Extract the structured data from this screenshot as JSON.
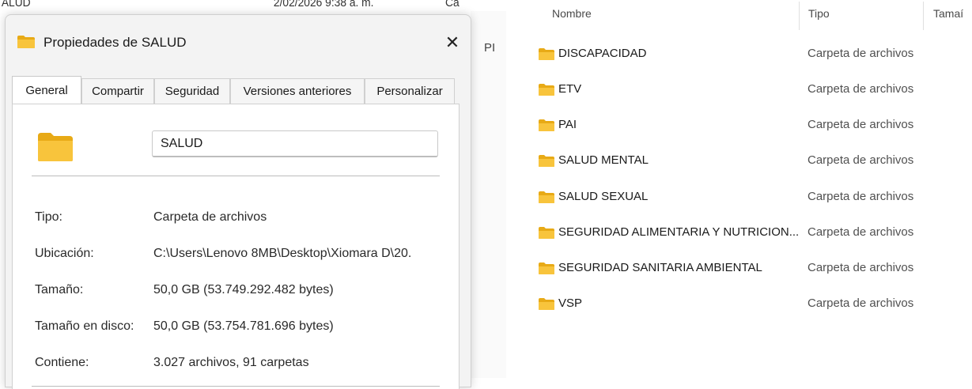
{
  "background": {
    "row_partial": {
      "name": "ALUD",
      "date": "2/02/2026 9:38 a. m.",
      "type": "Ca"
    },
    "right_pane_text": "PI"
  },
  "dialog": {
    "title": "Propiedades de SALUD",
    "close_label": "✕",
    "tabs": [
      {
        "label": "General",
        "active": true
      },
      {
        "label": "Compartir",
        "active": false
      },
      {
        "label": "Seguridad",
        "active": false
      },
      {
        "label": "Versiones anteriores",
        "active": false
      },
      {
        "label": "Personalizar",
        "active": false
      }
    ],
    "folder_name": "SALUD",
    "properties": [
      {
        "label": "Tipo:",
        "value": "Carpeta de archivos"
      },
      {
        "label": "Ubicación:",
        "value": "C:\\Users\\Lenovo 8MB\\Desktop\\Xiomara D\\20."
      },
      {
        "label": "Tamaño:",
        "value": "50,0 GB (53.749.292.482 bytes)"
      },
      {
        "label": "Tamaño en disco:",
        "value": "50,0 GB (53.754.781.696 bytes)"
      },
      {
        "label": "Contiene:",
        "value": "3.027 archivos, 91 carpetas"
      }
    ]
  },
  "explorer": {
    "columns": {
      "name": "Nombre",
      "type": "Tipo",
      "size": "Tamaí"
    },
    "items": [
      {
        "name": "DISCAPACIDAD",
        "type": "Carpeta de archivos"
      },
      {
        "name": "ETV",
        "type": "Carpeta de archivos"
      },
      {
        "name": "PAI",
        "type": "Carpeta de archivos"
      },
      {
        "name": "SALUD MENTAL",
        "type": "Carpeta de archivos"
      },
      {
        "name": "SALUD SEXUAL",
        "type": "Carpeta de archivos"
      },
      {
        "name": "SEGURIDAD ALIMENTARIA Y NUTRICION...",
        "type": "Carpeta de archivos"
      },
      {
        "name": "SEGURIDAD SANITARIA AMBIENTAL",
        "type": "Carpeta de archivos"
      },
      {
        "name": "VSP",
        "type": "Carpeta de archivos"
      }
    ]
  },
  "colors": {
    "folder": "#f8c43c",
    "folder_dark": "#e8aa16",
    "accent": "#0067c0"
  },
  "icons": {
    "folder": "folder-icon",
    "close": "close-icon"
  }
}
